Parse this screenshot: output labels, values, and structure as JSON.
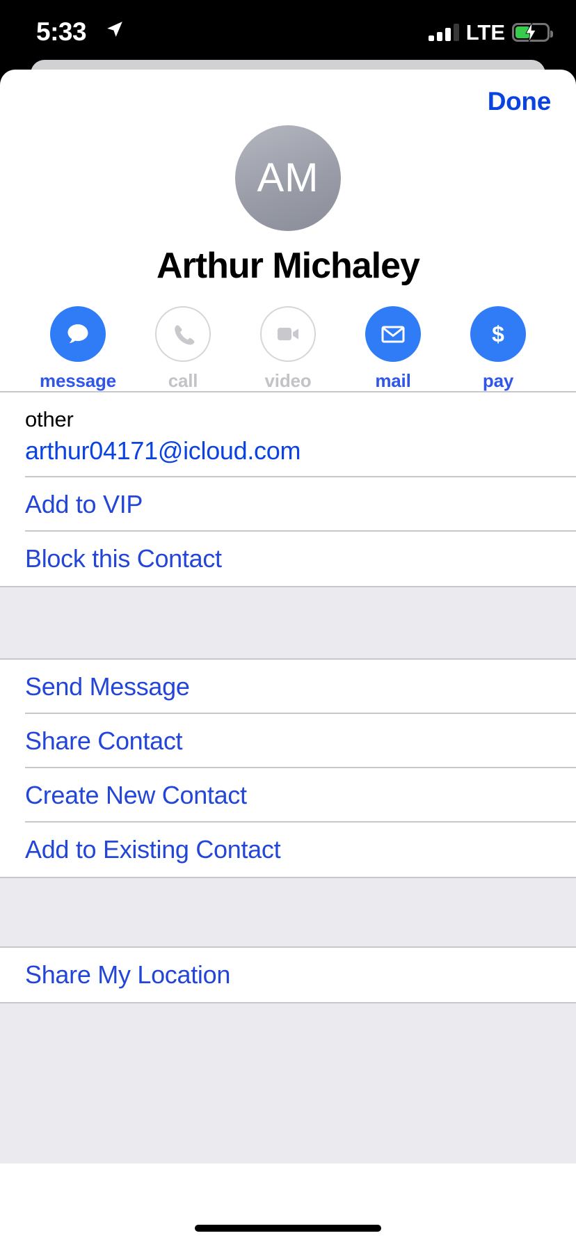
{
  "status_bar": {
    "time": "5:33",
    "location_arrow_icon": "location-arrow-icon",
    "signal_icon": "cellular-signal-icon",
    "signal_bars_active": 3,
    "signal_bars_total": 4,
    "carrier": "LTE",
    "battery_icon": "battery-charging-icon",
    "battery_percent": 48,
    "battery_color": "#37cc4b",
    "charging": true
  },
  "header": {
    "done_label": "Done"
  },
  "contact": {
    "avatar_initials": "AM",
    "name": "Arthur Michaley"
  },
  "quick_actions": [
    {
      "id": "message",
      "label": "message",
      "icon": "message-bubble-icon",
      "enabled": true
    },
    {
      "id": "call",
      "label": "call",
      "icon": "phone-icon",
      "enabled": false
    },
    {
      "id": "video",
      "label": "video",
      "icon": "video-camera-icon",
      "enabled": false
    },
    {
      "id": "mail",
      "label": "mail",
      "icon": "envelope-icon",
      "enabled": true
    },
    {
      "id": "pay",
      "label": "pay",
      "icon": "dollar-sign-icon",
      "enabled": true
    }
  ],
  "email_field": {
    "label": "other",
    "value": "arthur04171@icloud.com"
  },
  "group_one": [
    {
      "id": "add-to-vip",
      "label": "Add to VIP"
    },
    {
      "id": "block-this-contact",
      "label": "Block this Contact"
    }
  ],
  "group_two": [
    {
      "id": "send-message",
      "label": "Send Message"
    },
    {
      "id": "share-contact",
      "label": "Share Contact"
    },
    {
      "id": "create-new-contact",
      "label": "Create New Contact"
    },
    {
      "id": "add-to-existing-contact",
      "label": "Add to Existing Contact"
    }
  ],
  "group_three": [
    {
      "id": "share-my-location",
      "label": "Share My Location"
    }
  ],
  "colors": {
    "accent_blue": "#0a43e0",
    "link_blue": "#2346d8",
    "action_blue": "#2f7cf6",
    "disabled_gray": "#c2c2c7",
    "group_bg": "#ebebef",
    "separator": "#c8c7cc"
  }
}
